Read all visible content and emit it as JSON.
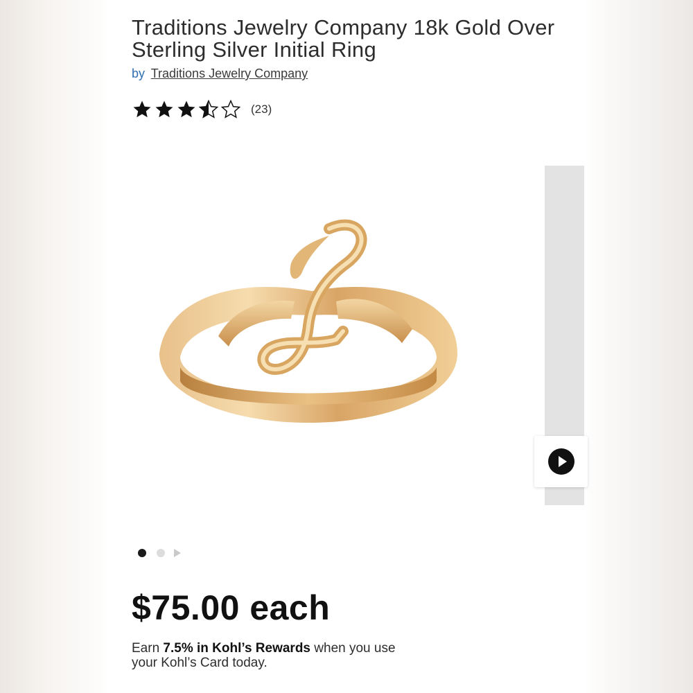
{
  "product": {
    "title": "Traditions Jewelry Company 18k Gold Over Sterling Silver Initial Ring",
    "by_label": "by",
    "brand": "Traditions Jewelry Company",
    "rating": 3.5,
    "rating_max": 5,
    "review_count": "(23)"
  },
  "gallery": {
    "image_icon": "gold-initial-ring-image",
    "video_icon": "play-icon",
    "pagination": {
      "total_dots": 2,
      "active_index": 0,
      "next_icon": "chevron-right-icon"
    }
  },
  "pricing": {
    "price": "$75.00 each"
  },
  "rewards": {
    "prefix": "Earn ",
    "highlight": "7.5% in Kohl’s Rewards",
    "suffix": " when you use your Kohl’s Card today."
  },
  "colors": {
    "link_blue": "#2f6fb3",
    "gold": "#d9a85c",
    "text_dark": "#111111"
  }
}
